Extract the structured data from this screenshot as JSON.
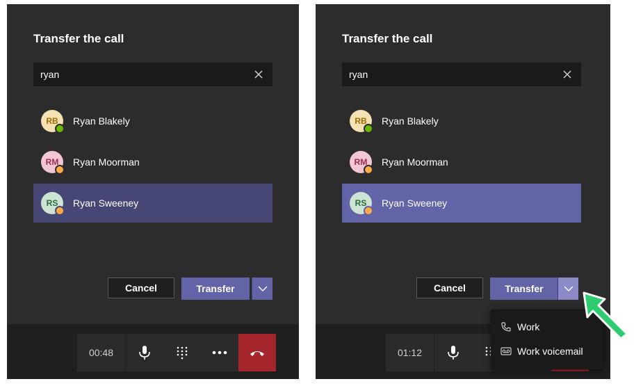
{
  "left": {
    "dialog_title": "Transfer the call",
    "search_value": "ryan",
    "contacts": [
      {
        "initials": "RB",
        "name": "Ryan Blakely",
        "status": "available"
      },
      {
        "initials": "RM",
        "name": "Ryan Moorman",
        "status": "away"
      },
      {
        "initials": "RS",
        "name": "Ryan Sweeney",
        "status": "away",
        "selected": true
      }
    ],
    "cancel_label": "Cancel",
    "transfer_label": "Transfer",
    "timer": "00:48"
  },
  "right": {
    "dialog_title": "Transfer the call",
    "search_value": "ryan",
    "contacts": [
      {
        "initials": "RB",
        "name": "Ryan Blakely",
        "status": "available"
      },
      {
        "initials": "RM",
        "name": "Ryan Moorman",
        "status": "away"
      },
      {
        "initials": "RS",
        "name": "Ryan Sweeney",
        "status": "away",
        "selected": true
      }
    ],
    "cancel_label": "Cancel",
    "transfer_label": "Transfer",
    "timer": "01:12",
    "menu": [
      {
        "icon": "phone-icon",
        "label": "Work"
      },
      {
        "icon": "voicemail-icon",
        "label": "Work voicemail"
      }
    ]
  },
  "colors": {
    "accent": "#6264a7",
    "selected_dark": "#464775",
    "available": "#6bb700",
    "away": "#ffaa44",
    "hangup": "#a4262c",
    "cursor": "#2ecc71"
  }
}
